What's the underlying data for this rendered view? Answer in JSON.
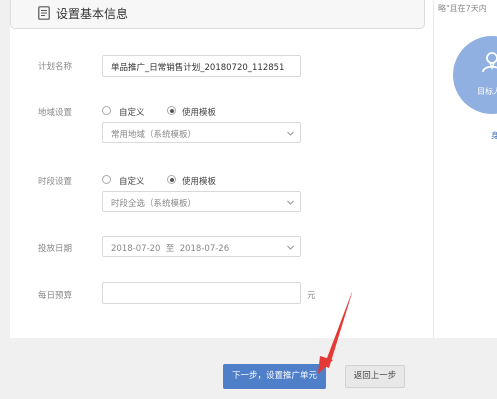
{
  "right_panel": {
    "note": "略\"且在7天内",
    "goal_label": "目标人",
    "link": "身"
  },
  "section": {
    "title": "设置基本信息"
  },
  "form": {
    "plan_name": {
      "label": "计划名称",
      "value": "单品推广_日常销售计划_20180720_112851"
    },
    "region": {
      "label": "地域设置",
      "option_custom": "自定义",
      "option_template": "使用模板",
      "selected": "使用模板",
      "select_value": "常用地域（系统模板）"
    },
    "time": {
      "label": "时段设置",
      "option_custom": "自定义",
      "option_template": "使用模板",
      "selected": "使用模板",
      "select_value": "时段全选（系统模板）"
    },
    "date": {
      "label": "投放日期",
      "value": "2018-07-20  至  2018-07-26"
    },
    "budget": {
      "label": "每日预算",
      "value": "",
      "unit": "元"
    }
  },
  "actions": {
    "next_label": "下一步，设置推广单元",
    "back_label": "返回上一步"
  },
  "colors": {
    "primary": "#4f7fc9",
    "annotation_arrow": "#e53935",
    "goal_circle": "#8fb0e0"
  }
}
